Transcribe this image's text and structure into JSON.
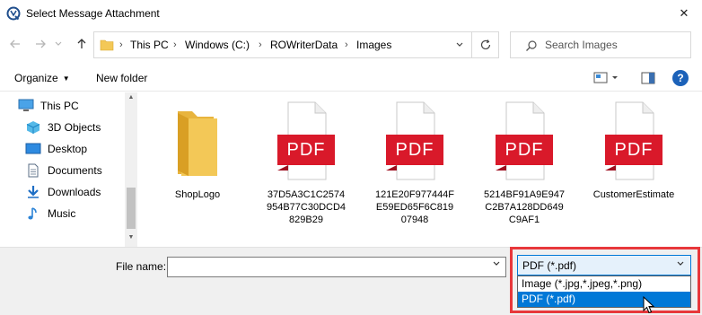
{
  "window": {
    "title": "Select Message Attachment",
    "close_symbol": "✕"
  },
  "address_bar": {
    "crumbs": [
      "This PC",
      "Windows (C:)",
      "ROWriterData",
      "Images"
    ],
    "separator": "›"
  },
  "search": {
    "placeholder": "Search Images"
  },
  "toolbar": {
    "organize_label": "Organize",
    "new_folder_label": "New folder",
    "help_label": "?"
  },
  "sidebar": {
    "items": [
      {
        "label": "This PC",
        "icon": "computer-icon"
      },
      {
        "label": "3D Objects",
        "icon": "cube-icon"
      },
      {
        "label": "Desktop",
        "icon": "desktop-icon"
      },
      {
        "label": "Documents",
        "icon": "documents-icon"
      },
      {
        "label": "Downloads",
        "icon": "download-arrow-icon"
      },
      {
        "label": "Music",
        "icon": "music-note-icon"
      }
    ]
  },
  "files": [
    {
      "name": "ShopLogo",
      "type": "folder"
    },
    {
      "name": "37D5A3C1C2574954B77C30DCD4829B29",
      "type": "pdf"
    },
    {
      "name": "121E20F977444FE59ED65F6C81907948",
      "type": "pdf"
    },
    {
      "name": "5214BF91A9E947C2B7A128DD649C9AF1",
      "type": "pdf"
    },
    {
      "name": "CustomerEstimate",
      "type": "pdf"
    }
  ],
  "pdf_badge_text": "PDF",
  "file_name": {
    "label": "File name:",
    "value": ""
  },
  "file_type": {
    "selected": "PDF (*.pdf)",
    "options": [
      "Image (*.jpg,*.jpeg,*.png)",
      "PDF (*.pdf)"
    ],
    "highlighted_index": 1
  },
  "colors": {
    "pdf_red": "#d9192a",
    "folder_yellow": "#f3c857",
    "selection_blue": "#0078d7",
    "annotation_red": "#e8383b"
  }
}
